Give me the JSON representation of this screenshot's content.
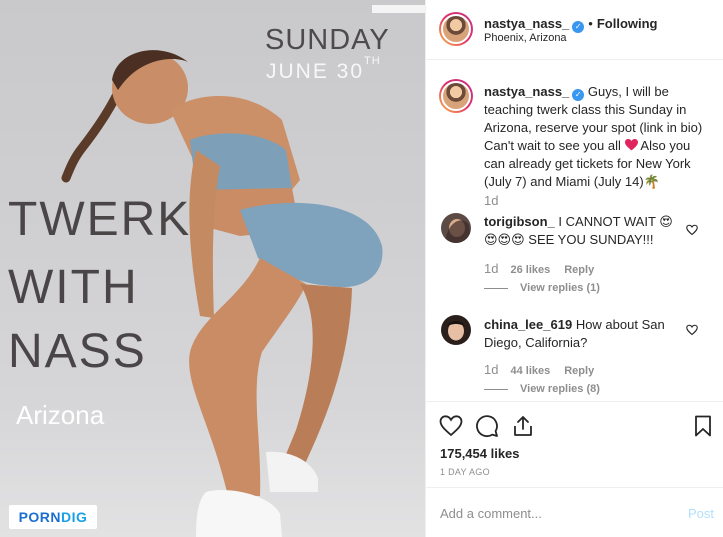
{
  "post": {
    "username": "nastya_nass_",
    "following_label": "Following",
    "location": "Phoenix, Arizona"
  },
  "poster": {
    "day": "SUNDAY",
    "date": "JUNE 30",
    "date_suffix": "TH",
    "line1": "TWERK",
    "line2": "WITH",
    "line3": "NASS",
    "city": "Arizona",
    "watermark_a": "PORN",
    "watermark_b": "DIG"
  },
  "caption": {
    "username": "nastya_nass_",
    "text_before_heart": "Guys, I will be teaching twerk class this Sunday in Arizona, reserve your spot (link in bio) Can't wait to see you all",
    "text_after_heart": "Also you can already get tickets for New York (July 7) and Miami (July 14)",
    "emoji_end": "🌴",
    "time": "1d"
  },
  "comments": [
    {
      "username": "torigibson_",
      "text": "I CANNOT WAIT 😍 😍😍😍 SEE YOU SUNDAY!!!",
      "time": "1d",
      "likes": "26 likes",
      "reply": "Reply",
      "view_replies": "View replies (1)"
    },
    {
      "username": "china_lee_619",
      "text": "How about San Diego, California?",
      "time": "1d",
      "likes": "44 likes",
      "reply": "Reply",
      "view_replies": "View replies (8)"
    }
  ],
  "stats": {
    "likes": "175,454 likes",
    "time_ago": "1 DAY AGO"
  },
  "add_comment": {
    "placeholder": "Add a comment...",
    "post_label": "Post"
  },
  "icons": {
    "like": "heart-icon",
    "comment": "comment-icon",
    "share": "share-icon",
    "save": "bookmark-icon",
    "verified": "verified-badge-icon"
  },
  "colors": {
    "verified": "#3897f0",
    "heart": "#e0245e",
    "post_disabled": "#b2dffc",
    "muted": "#8e8e8e"
  }
}
